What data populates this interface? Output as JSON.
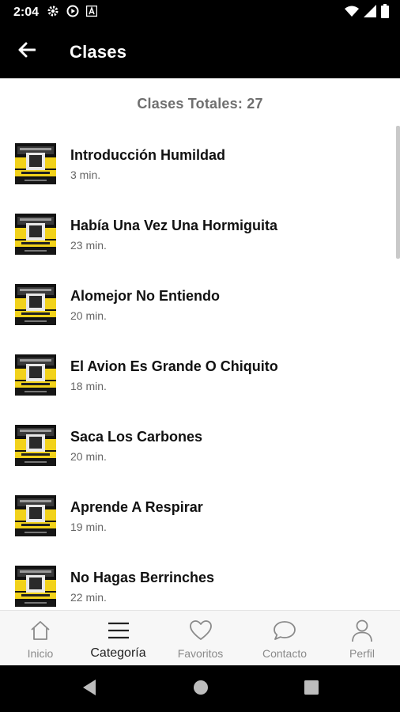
{
  "status_bar": {
    "time": "2:04",
    "left_icons": [
      "settings-icon",
      "play-circle-icon",
      "font-a-icon"
    ],
    "right_icons": [
      "wifi-icon",
      "signal-icon",
      "battery-icon"
    ]
  },
  "app_bar": {
    "title": "Clases",
    "back_icon": "arrow-left-icon"
  },
  "summary": {
    "total_label": "Clases Totales: 27"
  },
  "classes": [
    {
      "title": "Introducción Humildad",
      "duration": "3 min."
    },
    {
      "title": "Había Una Vez Una Hormiguita",
      "duration": "23 min."
    },
    {
      "title": "Alomejor No Entiendo",
      "duration": "20 min."
    },
    {
      "title": "El Avion Es Grande O Chiquito",
      "duration": "18 min."
    },
    {
      "title": "Saca Los Carbones",
      "duration": "20 min."
    },
    {
      "title": "Aprende A Respirar",
      "duration": "19 min."
    },
    {
      "title": "No Hagas Berrinches",
      "duration": "22 min."
    }
  ],
  "bottom_nav": {
    "items": [
      {
        "label": "Inicio",
        "icon": "home-icon",
        "active": false
      },
      {
        "label": "Categoría",
        "icon": "menu-icon",
        "active": true
      },
      {
        "label": "Favoritos",
        "icon": "heart-icon",
        "active": false
      },
      {
        "label": "Contacto",
        "icon": "chat-bubble-icon",
        "active": false
      },
      {
        "label": "Perfil",
        "icon": "person-icon",
        "active": false
      }
    ]
  },
  "system_nav": {
    "icons": [
      "back-triangle-icon",
      "home-circle-icon",
      "recents-square-icon"
    ]
  },
  "colors": {
    "header_bg": "#000000",
    "thumb_yellow": "#f2d21b",
    "text_primary": "#111111",
    "text_secondary": "#666666"
  }
}
